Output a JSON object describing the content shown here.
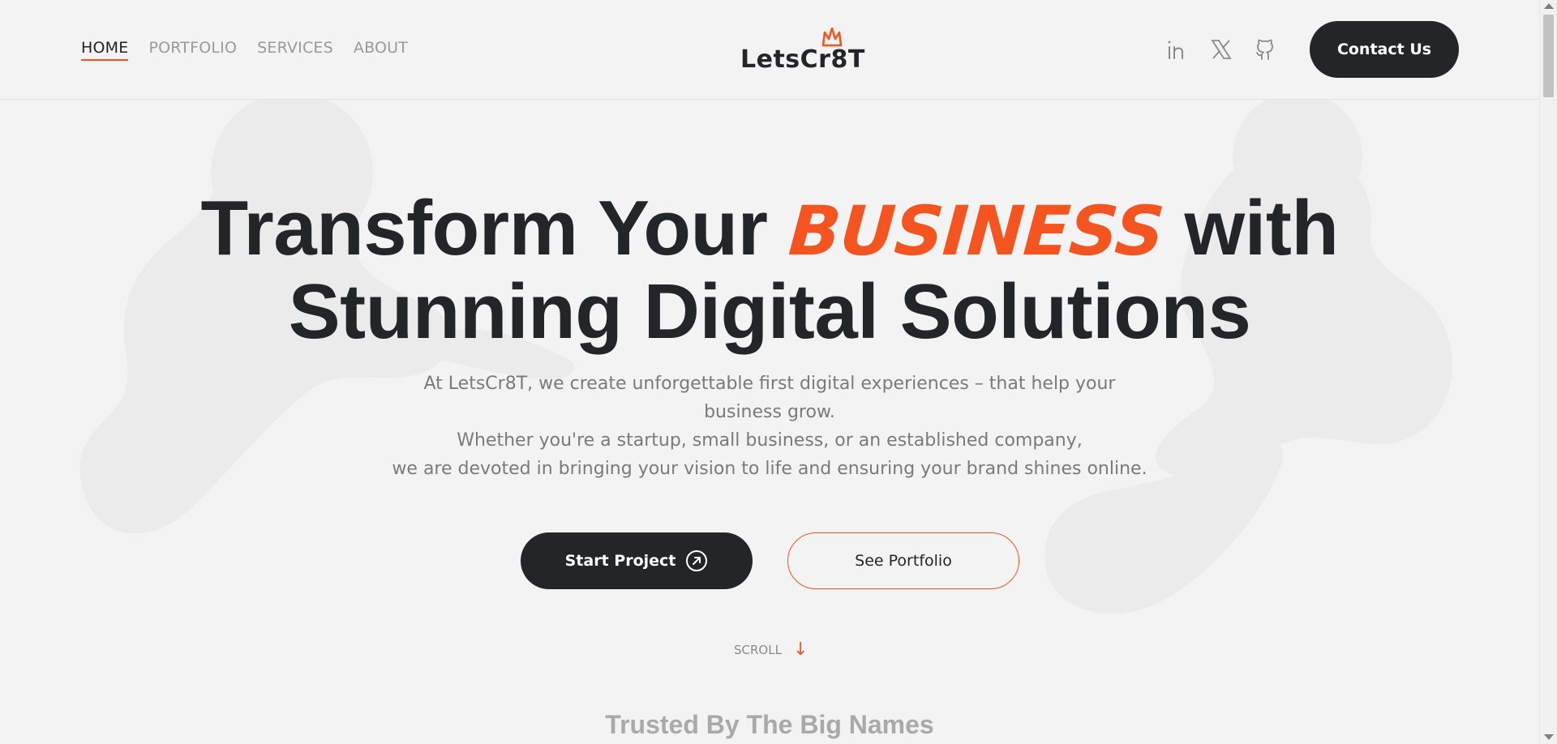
{
  "nav": {
    "items": [
      {
        "label": "HOME",
        "active": true
      },
      {
        "label": "PORTFOLIO",
        "active": false
      },
      {
        "label": "SERVICES",
        "active": false
      },
      {
        "label": "ABOUT",
        "active": false
      }
    ]
  },
  "logo": {
    "text": "LetsCr8T"
  },
  "socials": [
    {
      "icon": "linkedin-icon"
    },
    {
      "icon": "x-twitter-icon"
    },
    {
      "icon": "github-icon"
    }
  ],
  "header": {
    "contact_label": "Contact Us"
  },
  "hero": {
    "title_part1": "Transform Your",
    "title_accent": "BUSINESS",
    "title_part2": "with",
    "title_line2": "Stunning Digital Solutions",
    "desc_line1": "At LetsCr8T, we create unforgettable first digital experiences – that help your",
    "desc_line2": "business grow.",
    "desc_line3": "Whether you're a startup, small business, or an established company,",
    "desc_line4": "we are devoted in bringing your vision to life and ensuring your brand shines online.",
    "start_label": "Start Project",
    "portfolio_label": "See Portfolio",
    "scroll_label": "SCROLL",
    "scroll_arrow": "↓"
  },
  "trusted": {
    "heading": "Trusted By The Big Names"
  },
  "colors": {
    "accent": "#f4541f",
    "dark": "#222628",
    "background": "#f3f3f3",
    "muted_text": "#7a7a7a"
  }
}
